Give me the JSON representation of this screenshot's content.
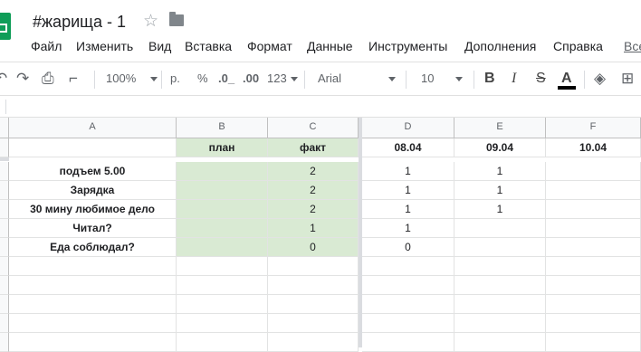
{
  "doc": {
    "title": "#жарища - 1"
  },
  "menu": [
    "Файл",
    "Изменить",
    "Вид",
    "Вставка",
    "Формат",
    "Данные",
    "Инструменты",
    "Дополнения",
    "Справка",
    "Все"
  ],
  "toolbar": {
    "zoom": "100%",
    "currency": "р.",
    "percent": "%",
    "dec_less": ".0_",
    "dec_more": ".00",
    "format_more": "123",
    "font": "Arial",
    "font_size": "10",
    "bold": "B",
    "italic": "I",
    "strike": "S",
    "text_color": "A"
  },
  "columns": [
    "A",
    "B",
    "C",
    "D",
    "E",
    "F"
  ],
  "rows": [
    [
      "",
      "план",
      "факт",
      "08.04",
      "09.04",
      "10.04"
    ],
    [
      "подъем 5.00",
      "",
      "2",
      "1",
      "1",
      ""
    ],
    [
      "Зарядка",
      "",
      "2",
      "1",
      "1",
      ""
    ],
    [
      "30 мину любимое дело",
      "",
      "2",
      "1",
      "1",
      ""
    ],
    [
      "Читал?",
      "",
      "1",
      "1",
      "",
      ""
    ],
    [
      "Еда соблюдал?",
      "",
      "0",
      "0",
      "",
      ""
    ]
  ],
  "colors": {
    "plan_fill": "#d9ead3",
    "text_color_bar": "#000000",
    "logo": "#0f9d58"
  }
}
